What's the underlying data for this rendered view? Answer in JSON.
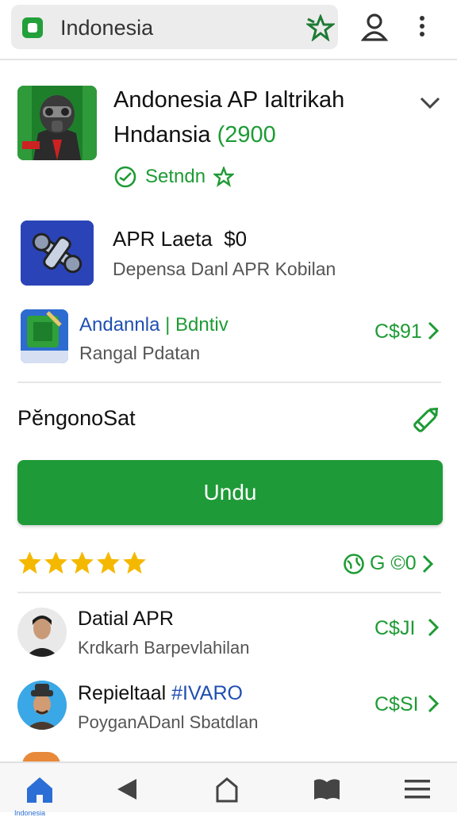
{
  "search": {
    "query": "Indonesia"
  },
  "featured": {
    "title_line1": "Andonesia AP Ialtrikah",
    "title_line2_main": "Hndansia",
    "title_line2_price": "(2900",
    "badge_text": "Setndn"
  },
  "list": [
    {
      "title": "APR Laeta",
      "price_inline": "$0",
      "subtitle": "Depensa Danl APR Kobilan"
    },
    {
      "title": "Andannla",
      "title_tag": "| Bdntiv",
      "subtitle": "Rangal Pdatan",
      "price": "C$91"
    }
  ],
  "section": {
    "label": "PĕngonoSat"
  },
  "cta": {
    "label": "Undu"
  },
  "rating": {
    "stars": 5,
    "value": "G ©0"
  },
  "people": [
    {
      "title": "Datial APR",
      "subtitle": "Krdkarh Barpevlahilan",
      "price": "C$JI"
    },
    {
      "title": "Repieltaal",
      "title_tag": "#IVARO",
      "subtitle": "PoyganADanl Sbatdlan",
      "price": "C$SI"
    }
  ],
  "bottom_nav": {
    "home_label": "Indonesia"
  },
  "colors": {
    "accent": "#1f9a38",
    "link_blue": "#1f4fb0",
    "star": "#f5b800"
  }
}
